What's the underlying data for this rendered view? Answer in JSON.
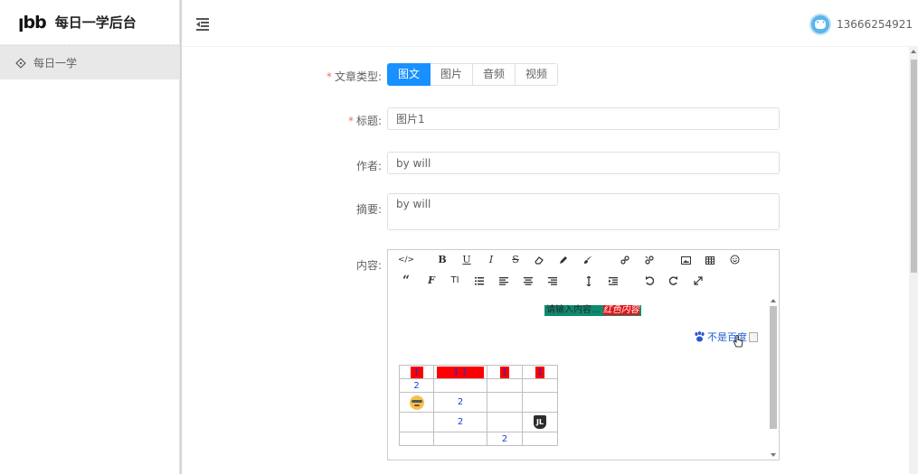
{
  "app": {
    "logo_mark": "ꞁbb",
    "title": "每日一学后台"
  },
  "sidebar": {
    "items": [
      {
        "label": "每日一学",
        "icon": "diamond-icon",
        "active": true
      }
    ]
  },
  "header": {
    "fold_icon": "menu-fold-icon",
    "user_phone": "13666254921",
    "avatar_icon": "chat-bubble-avatar"
  },
  "form": {
    "type_label": "文章类型:",
    "type_options": [
      "图文",
      "图片",
      "音频",
      "视频"
    ],
    "type_selected": "图文",
    "title_label": "标题:",
    "title_value": "图片1",
    "author_label": "作者:",
    "author_value": "by will",
    "summary_label": "摘要:",
    "summary_value": "by will",
    "content_label": "内容:"
  },
  "editor": {
    "toolbar_row1": [
      "</>",
      "B",
      "U",
      "I",
      "S",
      "eraser",
      "pencil",
      "brush",
      "link",
      "unlink",
      "image",
      "table",
      "emoji"
    ],
    "toolbar_row2": [
      "quote",
      "font",
      "TI",
      "list",
      "align-left",
      "align-center",
      "align-right",
      "line-height",
      "indent",
      "undo",
      "redo",
      "fullscreen"
    ],
    "content": {
      "highlight_text": "请输入内容...",
      "highlight_red": "红色内容",
      "link_text": "不是百度",
      "table_header": [
        "1",
        "1 1",
        "1",
        "1"
      ],
      "table_rows": [
        [
          "2",
          "",
          "",
          ""
        ],
        [
          "emoji",
          "2",
          "",
          ""
        ],
        [
          "",
          "2",
          "",
          "badge"
        ],
        [
          "",
          "",
          "2",
          ""
        ]
      ]
    }
  },
  "colors": {
    "primary": "#1890ff",
    "required": "#f56c6c",
    "highlight_bg": "#0e8a6e",
    "highlight_red": "#e0161b",
    "table_header_bg": "#ff0000"
  }
}
